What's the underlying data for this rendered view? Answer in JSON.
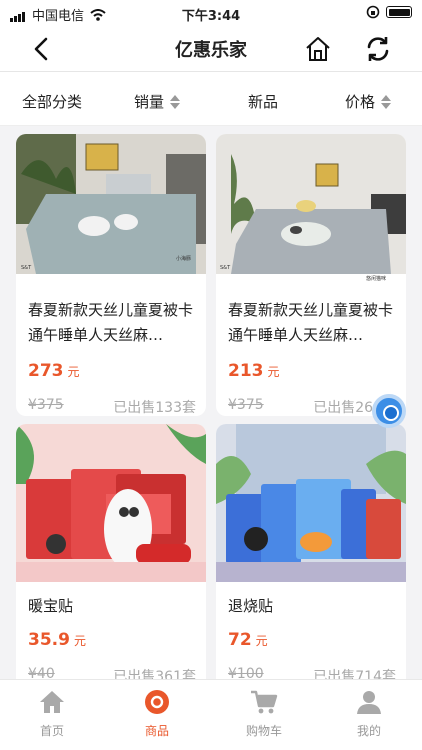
{
  "status_bar": {
    "carrier": "中国电信",
    "time": "下午3:44"
  },
  "header": {
    "title": "亿惠乐家"
  },
  "filters": {
    "all": "全部分类",
    "sales": "销量",
    "new": "新品",
    "price": "价格"
  },
  "products": [
    {
      "name": "春夏新款天丝儿童夏被卡通午睡单人天丝麻…",
      "price": "273",
      "unit": "元",
      "original": "¥375",
      "sold": "已出售133套"
    },
    {
      "name": "春夏新款天丝儿童夏被卡通午睡单人天丝麻…",
      "price": "213",
      "unit": "元",
      "original": "¥375",
      "sold": "已出售266套"
    },
    {
      "name": "暖宝贴",
      "price": "35.9",
      "unit": "元",
      "original": "¥40",
      "sold": "已出售361套"
    },
    {
      "name": "退烧贴",
      "price": "72",
      "unit": "元",
      "original": "¥100",
      "sold": "已出售714套"
    }
  ],
  "tabbar": {
    "items": [
      {
        "label": "首页"
      },
      {
        "label": "商品"
      },
      {
        "label": "购物车"
      },
      {
        "label": "我的"
      }
    ]
  },
  "colors": {
    "accent": "#e9572b",
    "inactive": "#999999",
    "float_button": "#3c8ee6"
  }
}
